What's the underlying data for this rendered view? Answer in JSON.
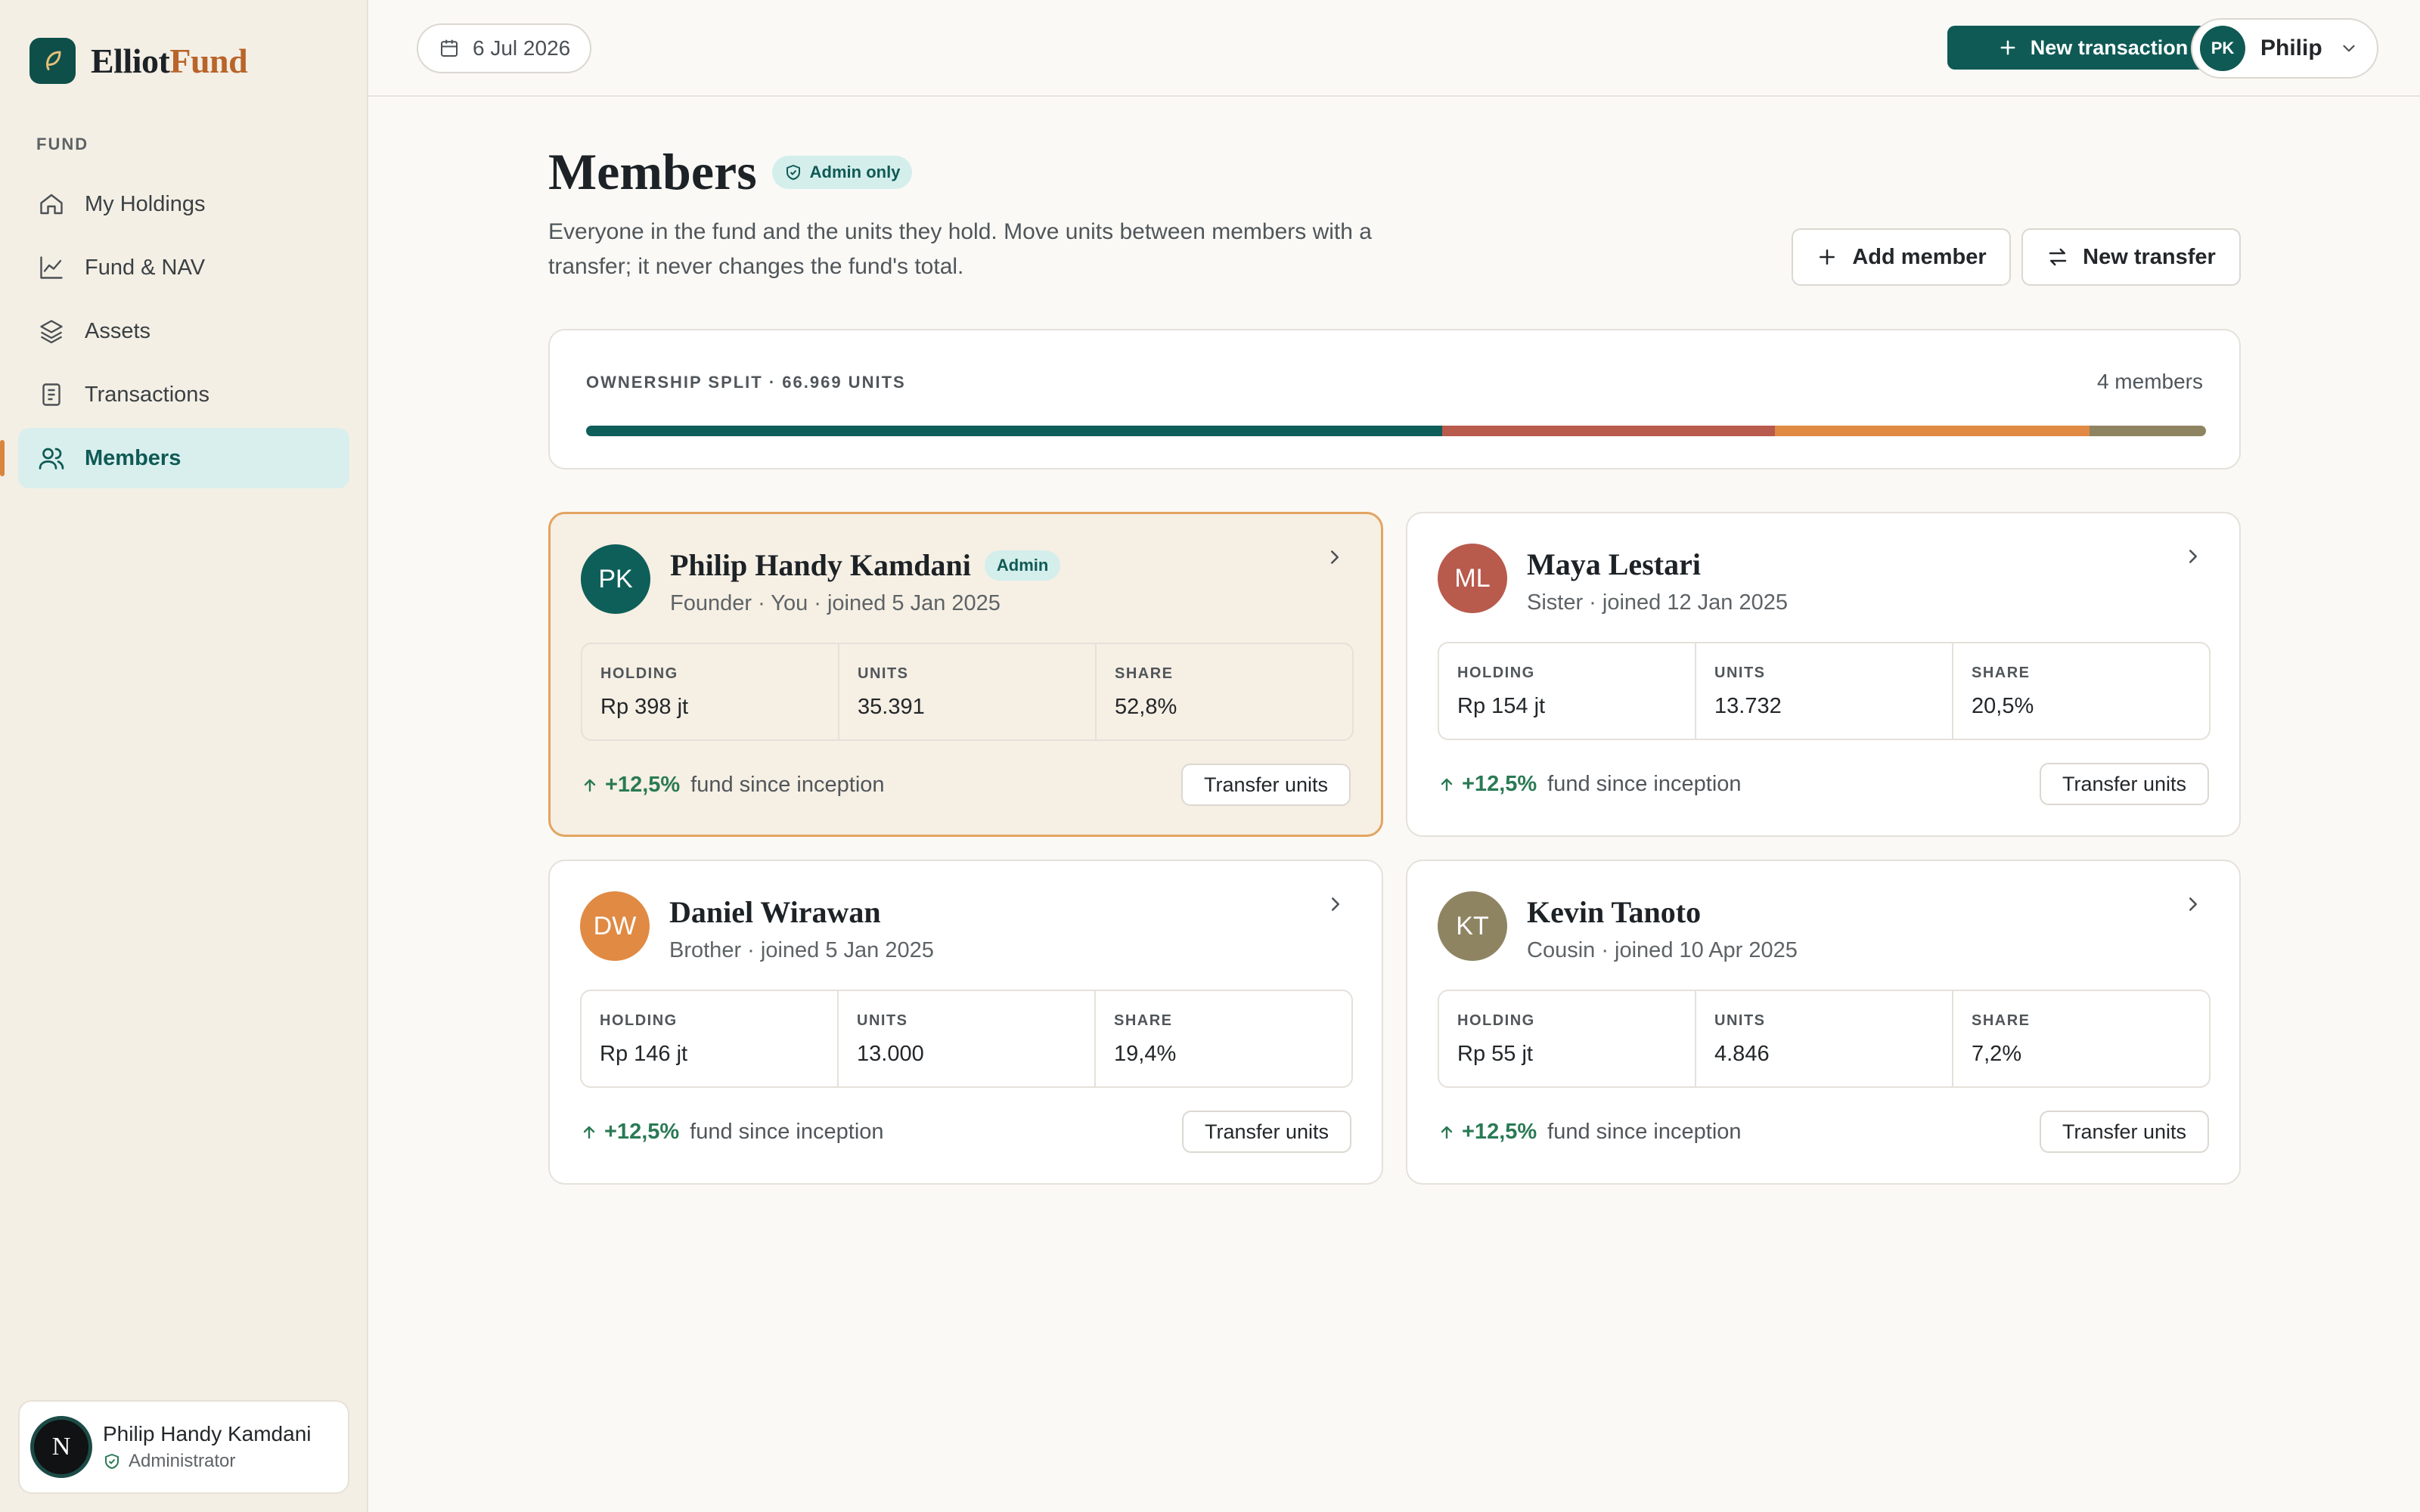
{
  "brand": {
    "part1": "Elliot",
    "part2": "Fund"
  },
  "sidebar": {
    "section": "FUND",
    "items": [
      {
        "label": "My Holdings",
        "icon": "home-icon"
      },
      {
        "label": "Fund & NAV",
        "icon": "chart-line-icon"
      },
      {
        "label": "Assets",
        "icon": "layers-icon"
      },
      {
        "label": "Transactions",
        "icon": "document-icon"
      },
      {
        "label": "Members",
        "icon": "users-icon",
        "active": true
      }
    ],
    "user": {
      "initial": "N",
      "name": "Philip Handy Kamdani",
      "role": "Administrator"
    }
  },
  "topbar": {
    "date": "6 Jul 2026",
    "new_transaction": "New transaction",
    "user_initials": "PK",
    "user_name": "Philip"
  },
  "page": {
    "title": "Members",
    "badge": "Admin only",
    "description": "Everyone in the fund and the units they hold. Move units between members with a transfer; it never changes the fund's total.",
    "add_member": "Add member",
    "new_transfer": "New transfer"
  },
  "ownership": {
    "label": "OWNERSHIP SPLIT · 66.969 UNITS",
    "count": "4 members",
    "segments": [
      {
        "member": "Philip Handy Kamdani",
        "share": 52.8,
        "color": "#0e5f59"
      },
      {
        "member": "Maya Lestari",
        "share": 20.5,
        "color": "#b85a4c"
      },
      {
        "member": "Daniel Wirawan",
        "share": 19.4,
        "color": "#e08a43"
      },
      {
        "member": "Kevin Tanoto",
        "share": 7.2,
        "color": "#8f8462"
      }
    ]
  },
  "labels": {
    "holding": "HOLDING",
    "units": "UNITS",
    "share": "SHARE",
    "since": "fund since inception",
    "transfer": "Transfer units"
  },
  "members": [
    {
      "initials": "PK",
      "name": "Philip Handy Kamdani",
      "badge": "Admin",
      "subtitle": "Founder · You · joined 5 Jan 2025",
      "holding": "Rp 398 jt",
      "units": "35.391",
      "share": "52,8%",
      "performance": "+12,5%",
      "avatar_color": "#0e5f59"
    },
    {
      "initials": "ML",
      "name": "Maya Lestari",
      "subtitle": "Sister · joined 12 Jan 2025",
      "holding": "Rp 154 jt",
      "units": "13.732",
      "share": "20,5%",
      "performance": "+12,5%",
      "avatar_color": "#b85a4c"
    },
    {
      "initials": "DW",
      "name": "Daniel Wirawan",
      "subtitle": "Brother · joined 5 Jan 2025",
      "holding": "Rp 146 jt",
      "units": "13.000",
      "share": "19,4%",
      "performance": "+12,5%",
      "avatar_color": "#e08a43"
    },
    {
      "initials": "KT",
      "name": "Kevin Tanoto",
      "subtitle": "Cousin · joined 10 Apr 2025",
      "holding": "Rp 55 jt",
      "units": "4.846",
      "share": "7,2%",
      "performance": "+12,5%",
      "avatar_color": "#8f8462"
    }
  ]
}
